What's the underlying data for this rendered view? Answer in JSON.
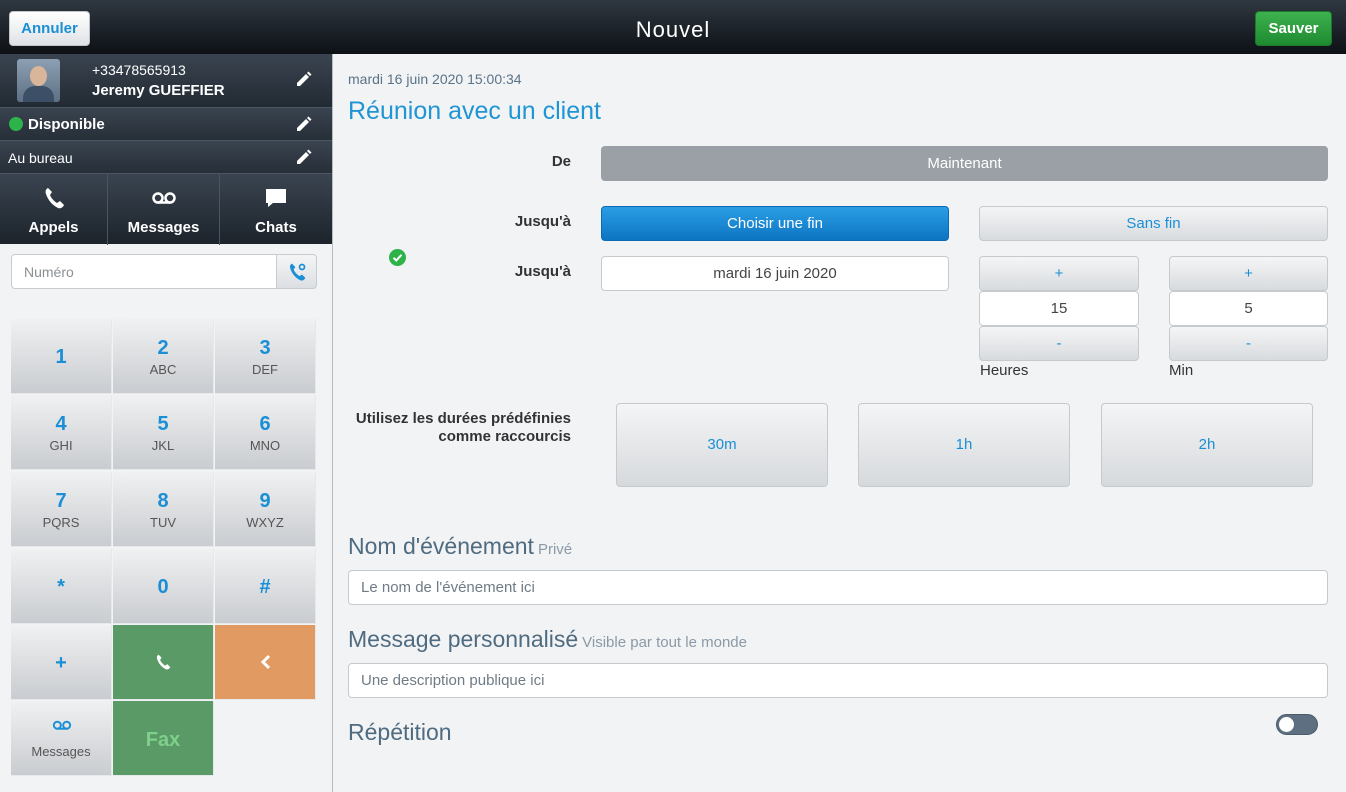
{
  "topbar": {
    "title": "Nouvel",
    "cancel_label": "Annuler",
    "save_label": "Sauver"
  },
  "profile": {
    "phone": "+33478565913",
    "name": "Jeremy GUEFFIER"
  },
  "status": {
    "label": "Disponible",
    "color": "#2eb24a"
  },
  "location": {
    "label": "Au bureau"
  },
  "nav": {
    "tabs": [
      {
        "label": "Appels",
        "icon": "phone-icon"
      },
      {
        "label": "Messages",
        "icon": "voicemail-icon"
      },
      {
        "label": "Chats",
        "icon": "chat-bubble-icon"
      }
    ]
  },
  "dialer": {
    "placeholder": "Numéro",
    "keys": [
      {
        "digit": "1",
        "letters": ""
      },
      {
        "digit": "2",
        "letters": "ABC"
      },
      {
        "digit": "3",
        "letters": "DEF"
      },
      {
        "digit": "4",
        "letters": "GHI"
      },
      {
        "digit": "5",
        "letters": "JKL"
      },
      {
        "digit": "6",
        "letters": "MNO"
      },
      {
        "digit": "7",
        "letters": "PQRS"
      },
      {
        "digit": "8",
        "letters": "TUV"
      },
      {
        "digit": "9",
        "letters": "WXYZ"
      },
      {
        "digit": "*",
        "letters": ""
      },
      {
        "digit": "0",
        "letters": ""
      },
      {
        "digit": "#",
        "letters": ""
      },
      {
        "digit": "+",
        "letters": ""
      }
    ],
    "messages_label": "Messages",
    "fax_label": "Fax"
  },
  "main": {
    "date": "mardi 16 juin 2020 15:00:34",
    "heading": "Réunion avec un client",
    "from_label": "De",
    "from_value": "Maintenant",
    "until_label": "Jusqu'à",
    "choose_end": "Choisir une fin",
    "no_end": "Sans fin",
    "until_label2": "Jusqu'à",
    "end_date": "mardi 16 juin 2020",
    "hours": {
      "plus": "+",
      "value": "15",
      "minus": "-",
      "label": "Heures"
    },
    "minutes": {
      "plus": "+",
      "value": "5",
      "minus": "-",
      "label": "Min"
    },
    "shortcuts_label_1": "Utilisez les durées prédéfinies",
    "shortcuts_label_2": "comme raccourcis",
    "shortcuts": [
      "30m",
      "1h",
      "2h"
    ],
    "event_name_title": "Nom d'événement",
    "event_name_sub": "Privé",
    "event_name_placeholder": "Le nom de l'événement ici",
    "message_title": "Message personnalisé",
    "message_sub": "Visible par tout le monde",
    "message_placeholder": "Une description publique ici",
    "repeat_title": "Répétition",
    "repeat_enabled": false
  }
}
